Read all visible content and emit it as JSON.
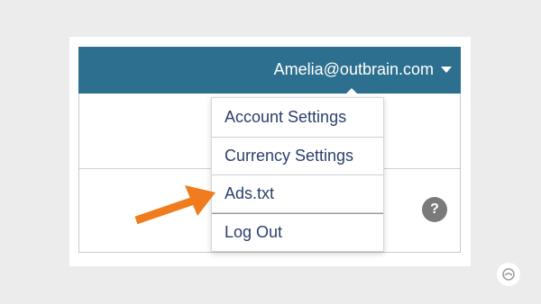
{
  "header": {
    "user_email": "Amelia@outbrain.com",
    "caret_icon": "caret-down-icon"
  },
  "menu": {
    "items": [
      {
        "label": "Account Settings"
      },
      {
        "label": "Currency Settings"
      },
      {
        "label": "Ads.txt"
      },
      {
        "label": "Log Out"
      }
    ]
  },
  "help": {
    "icon": "help-icon",
    "glyph": "?"
  },
  "colors": {
    "header_bg": "#2d6f8f",
    "menu_text": "#2c3e6e",
    "arrow": "#f07c1e"
  }
}
